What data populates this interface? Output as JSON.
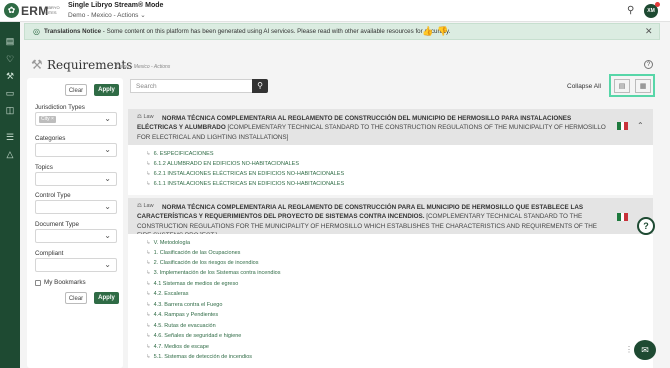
{
  "header": {
    "logo_text": "ERM",
    "logo_sub": "LIBRYO SITES",
    "app_title": "Single Libryo Stream® Mode",
    "breadcrumb": "Demo - Mexico - Actions",
    "avatar_initials": "XM"
  },
  "notice": {
    "title": "Translations Notice",
    "text": " - Some content on this platform has been generated using AI services. Please read with other available resources for accuracy."
  },
  "page": {
    "title": "Requirements",
    "breadcrumb": "Demo - Mexico - Actions"
  },
  "filters": {
    "clear_label": "Clear",
    "apply_label": "Apply",
    "jurisdiction_label": "Jurisdiction Types",
    "jurisdiction_chip": "City",
    "categories_label": "Categories",
    "topics_label": "Topics",
    "control_type_label": "Control Type",
    "document_type_label": "Document Type",
    "compliant_label": "Compliant",
    "bookmarks_label": "My Bookmarks"
  },
  "toolbar": {
    "search_placeholder": "Search",
    "collapse_all": "Collapse All"
  },
  "laws": [
    {
      "tag": "Law",
      "title": "NORMA TÉCNICA COMPLEMENTARIA AL REGLAMENTO DE CONSTRUCCIÓN DEL MUNICIPIO DE HERMOSILLO PARA INSTALACIONES ELÉCTRICAS Y ALUMBRADO",
      "translation": "[COMPLEMENTARY TECHNICAL STANDARD TO THE CONSTRUCTION REGULATIONS OF THE MUNICIPALITY OF HERMOSILLO FOR ELECTRICAL AND LIGHTING INSTALLATIONS]",
      "items": [
        "6. ESPECIFICACIONES",
        "6.1.2 ALUMBRADO EN EDIFICIOS NO-HABITACIONALES",
        "6.2.1 INSTALACIONES ELÉCTRICAS EN EDIFICIOS NO-HABITACIONALES",
        "6.1.1 INSTALACIONES ELÉCTRICAS EN EDIFICIOS NO-HABITACIONALES"
      ]
    },
    {
      "tag": "Law",
      "title": "NORMA TÉCNICA COMPLEMENTARIA AL REGLAMENTO DE CONSTRUCCIÓN PARA EL MUNICIPIO DE HERMOSILLO QUE ESTABLECE LAS CARACTERÍSTICAS Y REQUERIMIENTOS DEL PROYECTO DE SISTEMAS CONTRA INCENDIOS.",
      "translation": "[COMPLEMENTARY TECHNICAL STANDARD TO THE CONSTRUCTION REGULATIONS FOR THE MUNICIPALITY OF HERMOSILLO WHICH ESTABLISHES THE CHARACTERISTICS AND REQUIREMENTS OF THE FIRE SYSTEMS PROJECT.]",
      "items": [
        "V. Metodología",
        "1. Clasificación de las Ocupaciones",
        "2. Clasificación de los riesgos de incendios",
        "3. Implementación de los Sistemas contra incendios",
        "4.1 Sistemas de medios de egreso",
        "4.2. Escaleras",
        "4.3. Barrera contra el Fuego",
        "4.4. Rampas y Pendientes",
        "4.5. Rutas de evacuación",
        "4.6. Señales de seguridad e higiene",
        "4.7. Medios de escape",
        "5.1. Sistemas de detección de incendios"
      ]
    }
  ],
  "colors": {
    "brand": "#1e4a32",
    "accent": "#2f6b45",
    "highlight": "#57d6a8"
  }
}
